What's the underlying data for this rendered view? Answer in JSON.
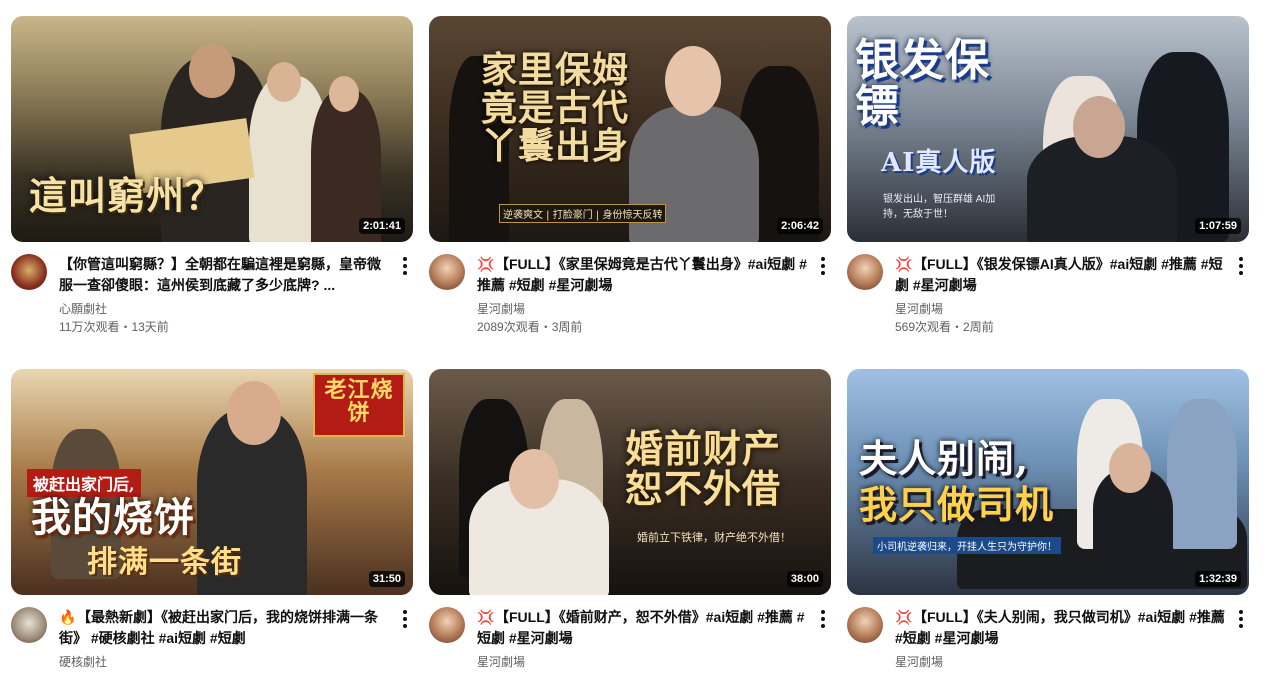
{
  "videos": [
    {
      "thumb_title": "這叫窮州？",
      "thumb_sub": "",
      "duration": "2:01:41",
      "title": "【你管這叫窮縣？】全朝都在騙這裡是窮縣，皇帝微服一查卻傻眼：這州侯到底藏了多少底牌? ...",
      "emoji": "",
      "channel": "心願劇社",
      "stats": "11万次观看・13天前"
    },
    {
      "thumb_title": "家里保姆竟是古代丫鬟出身",
      "thumb_sub": "逆袭爽文 | 打脸豪门 | 身份惊天反转",
      "duration": "2:06:42",
      "title": "【FULL】《家里保姆竟是古代丫鬟出身》#ai短劇 #推薦 #短劇 #星河劇場",
      "emoji": "💢",
      "channel": "星河劇場",
      "stats": "2089次观看・3周前"
    },
    {
      "thumb_title": "银发保镖",
      "thumb_sub2": "AI真人版",
      "thumb_sub": "银发出山，智压群雄 AI加持，无敌于世！",
      "duration": "1:07:59",
      "title": "【FULL】《银发保镖AI真人版》#ai短劇 #推薦 #短劇 #星河劇場",
      "emoji": "💢",
      "channel": "星河劇場",
      "stats": "569次观看・2周前"
    },
    {
      "thumb_title": "我的烧饼",
      "thumb_top": "被赶出家门后,",
      "thumb_sub2": "排满一条街",
      "thumb_sign": "老江烧饼",
      "thumb_sub": "",
      "duration": "31:50",
      "title": "【最熱新劇】《被赶出家门后，我的烧饼排满一条街》 #硬核劇社 #ai短劇 #短劇",
      "emoji": "🔥",
      "channel": "硬核劇社",
      "stats": ""
    },
    {
      "thumb_title": "婚前财产恕不外借",
      "thumb_sub": "婚前立下铁律，财产绝不外借！",
      "duration": "38:00",
      "title": "【FULL】《婚前财产，恕不外借》#ai短劇 #推薦 #短劇 #星河劇場",
      "emoji": "💢",
      "channel": "星河劇場",
      "stats": ""
    },
    {
      "thumb_title": "夫人别闹,",
      "thumb_sub2": "我只做司机",
      "thumb_sub": "小司机逆袭归来，开挂人生只为守护你！",
      "duration": "1:32:39",
      "title": "【FULL】《夫人别闹，我只做司机》#ai短劇 #推薦 #短劇 #星河劇場",
      "emoji": "💢",
      "channel": "星河劇場",
      "stats": ""
    }
  ],
  "colors": {
    "text": "#0f0f0f",
    "secondary": "#606060"
  }
}
